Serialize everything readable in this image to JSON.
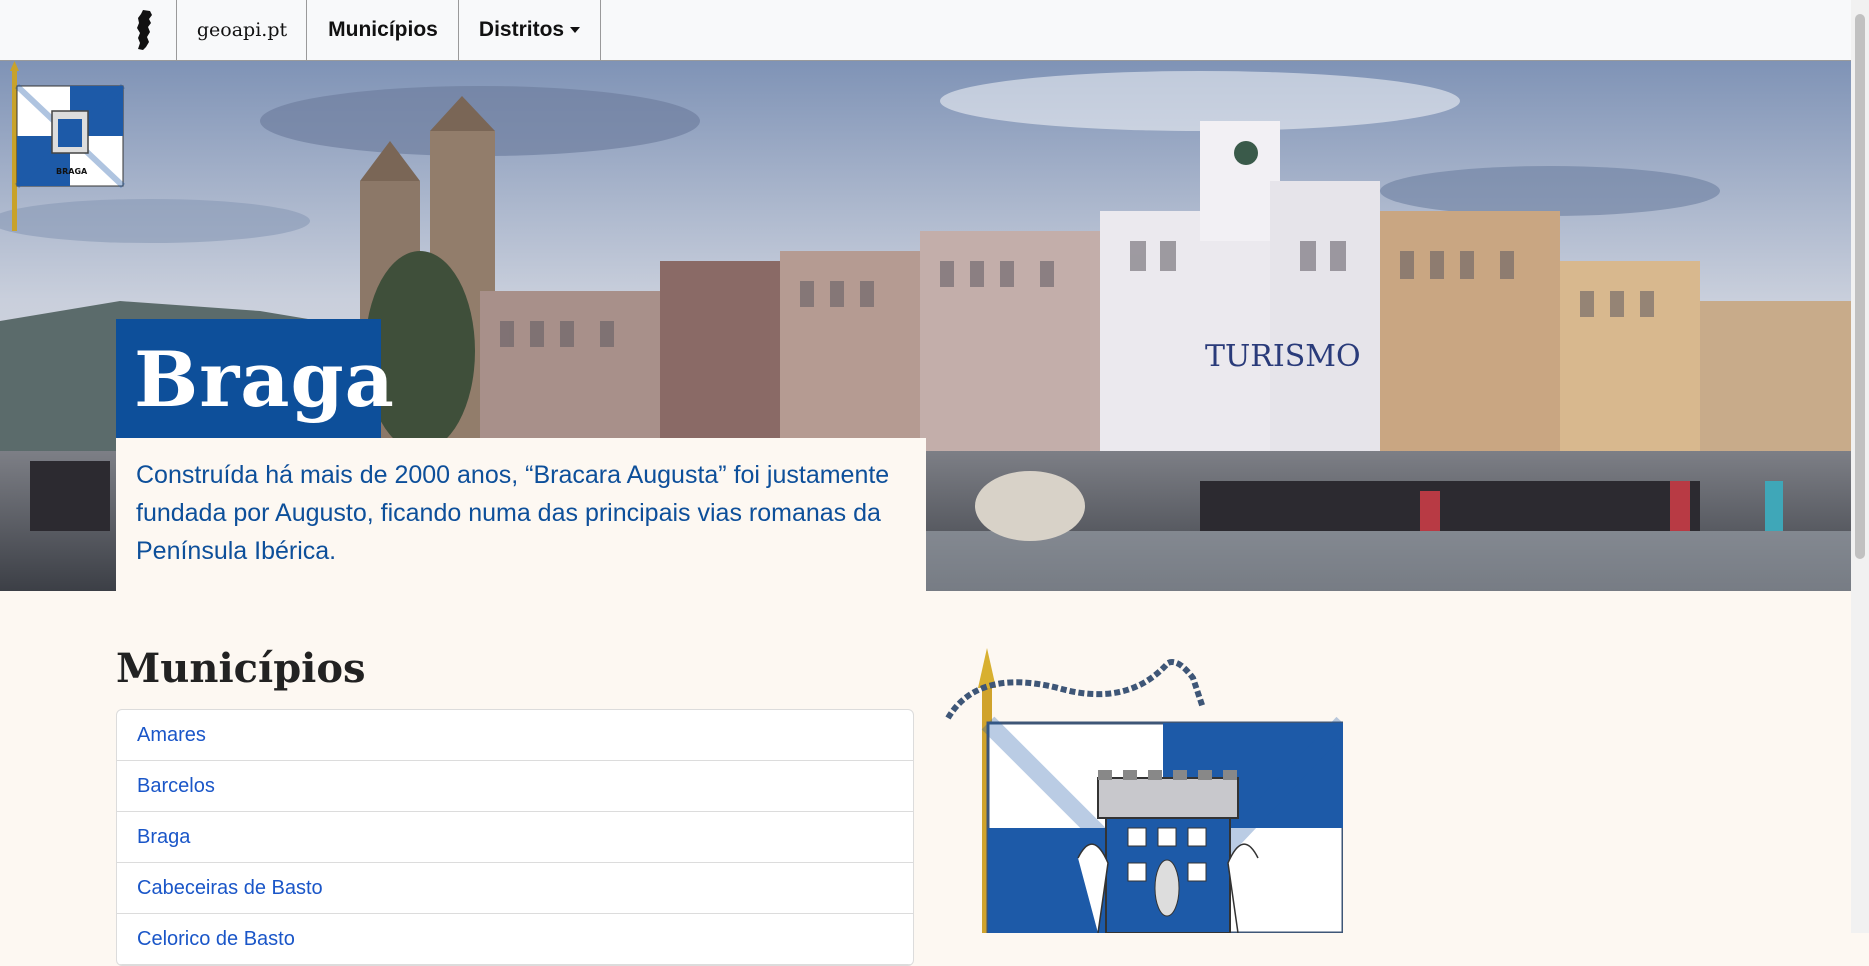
{
  "nav": {
    "brand": "geoapi.pt",
    "municipios": "Municípios",
    "distritos": "Distritos"
  },
  "hero": {
    "title": "Braga",
    "description": "Construída há mais de 2000 anos, “Bracara Augusta” foi justamente fundada por Augusto, ficando numa das principais vias romanas da Península Ibérica.",
    "sign_text": "TURISMO",
    "flag_label": "BRAGA"
  },
  "municipios": {
    "title": "Municípios",
    "items": [
      "Amares",
      "Barcelos",
      "Braga",
      "Cabeceiras de Basto",
      "Celorico de Basto"
    ]
  },
  "colors": {
    "brand_blue": "#0d4f9a",
    "link_blue": "#1a56c8",
    "page_bg": "#fdf8f2"
  },
  "icons": [
    "portugal-map-icon",
    "caret-down-icon",
    "braga-flag-icon"
  ]
}
